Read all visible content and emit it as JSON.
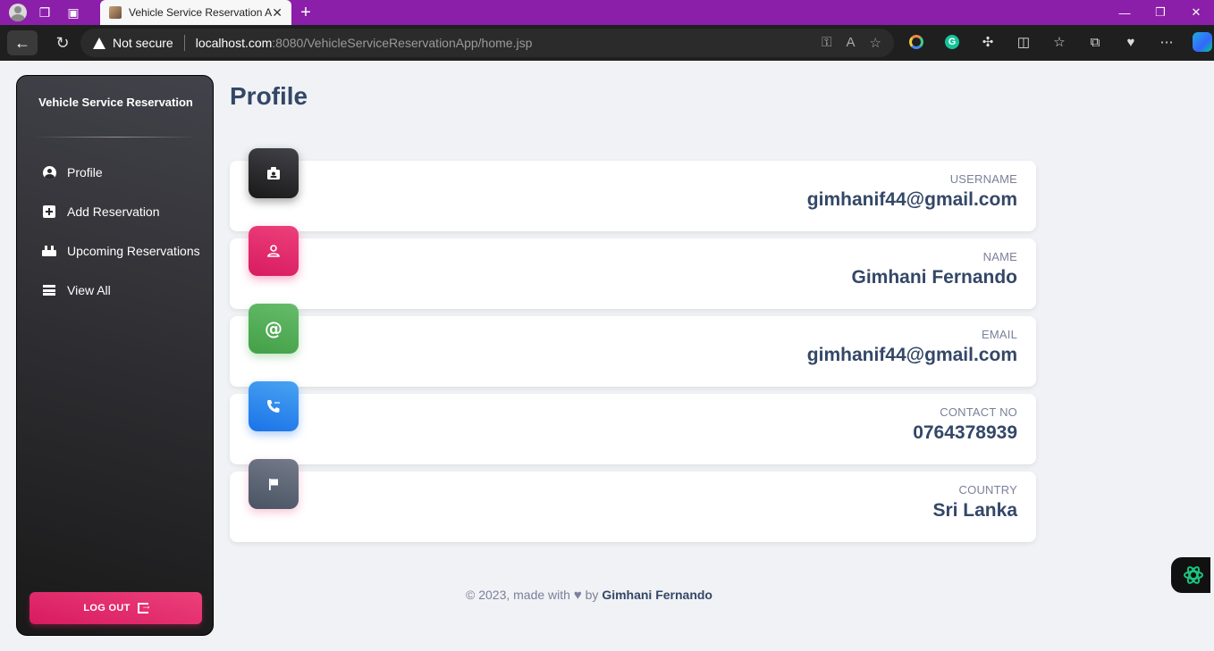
{
  "browser": {
    "tab_title": "Vehicle Service Reservation App",
    "not_secure": "Not secure",
    "url_host": "localhost.com",
    "url_path": ":8080/VehicleServiceReservationApp/home.jsp"
  },
  "sidebar": {
    "brand": "Vehicle Service Reservation",
    "items": [
      {
        "label": "Profile",
        "icon": "user-circle-icon"
      },
      {
        "label": "Add Reservation",
        "icon": "plus-square-icon"
      },
      {
        "label": "Upcoming Reservations",
        "icon": "calendar-icon"
      },
      {
        "label": "View All",
        "icon": "list-icon"
      }
    ],
    "logout_label": "LOG OUT"
  },
  "main": {
    "title": "Profile",
    "cards": [
      {
        "label": "USERNAME",
        "value": "gimhanif44@gmail.com",
        "icon": "id-badge-icon",
        "color": "#191919"
      },
      {
        "label": "NAME",
        "value": "Gimhani Fernando",
        "icon": "person-icon",
        "color": "#d81b60"
      },
      {
        "label": "EMAIL",
        "value": "gimhanif44@gmail.com",
        "icon": "at-icon",
        "color": "#43a047"
      },
      {
        "label": "CONTACT NO",
        "value": "0764378939",
        "icon": "phone-icon",
        "color": "#1a73e8"
      },
      {
        "label": "COUNTRY",
        "value": "Sri Lanka",
        "icon": "flag-icon",
        "color": "#495361"
      }
    ]
  },
  "footer": {
    "prefix": "© 2023, made with",
    "by": "by",
    "author": "Gimhani Fernando"
  }
}
